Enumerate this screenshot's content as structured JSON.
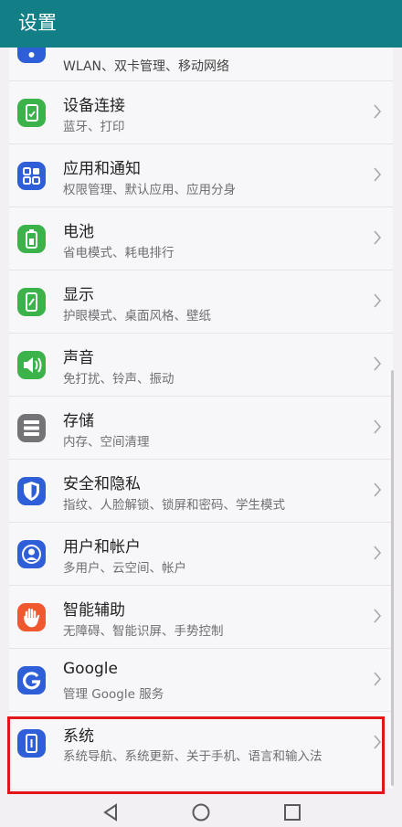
{
  "header": {
    "title": "设置"
  },
  "items": [
    {
      "title": "",
      "subtitle": "WLAN、双卡管理、移动网络",
      "icon": "wireless-icon",
      "color": "#2f5fd8"
    },
    {
      "title": "设备连接",
      "subtitle": "蓝牙、打印",
      "icon": "device-connection-icon",
      "color": "#3bb24a"
    },
    {
      "title": "应用和通知",
      "subtitle": "权限管理、默认应用、应用分身",
      "icon": "apps-grid-icon",
      "color": "#2f5fd8"
    },
    {
      "title": "电池",
      "subtitle": "省电模式、耗电排行",
      "icon": "battery-icon",
      "color": "#3bb24a"
    },
    {
      "title": "显示",
      "subtitle": "护眼模式、桌面风格、壁纸",
      "icon": "display-icon",
      "color": "#3bb24a"
    },
    {
      "title": "声音",
      "subtitle": "免打扰、铃声、振动",
      "icon": "sound-icon",
      "color": "#3bb24a"
    },
    {
      "title": "存储",
      "subtitle": "内存、空间清理",
      "icon": "storage-icon",
      "color": "#737378"
    },
    {
      "title": "安全和隐私",
      "subtitle": "指纹、人脸解锁、锁屏和密码、学生模式",
      "icon": "shield-icon",
      "color": "#2f5fd8"
    },
    {
      "title": "用户和帐户",
      "subtitle": "多用户、云空间、帐户",
      "icon": "user-icon",
      "color": "#2f5fd8"
    },
    {
      "title": "智能辅助",
      "subtitle": "无障碍、智能识屏、手势控制",
      "icon": "hand-icon",
      "color": "#f0582f"
    },
    {
      "title": "Google",
      "subtitle": "管理 Google 服务",
      "icon": "google-icon",
      "color": "#2f5fd8"
    },
    {
      "title": "系统",
      "subtitle": "系统导航、系统更新、关于手机、语言和输入法",
      "icon": "system-icon",
      "color": "#2f5fd8"
    }
  ],
  "nav": {
    "back": "back-icon",
    "home": "home-icon",
    "recent": "recent-apps-icon"
  }
}
